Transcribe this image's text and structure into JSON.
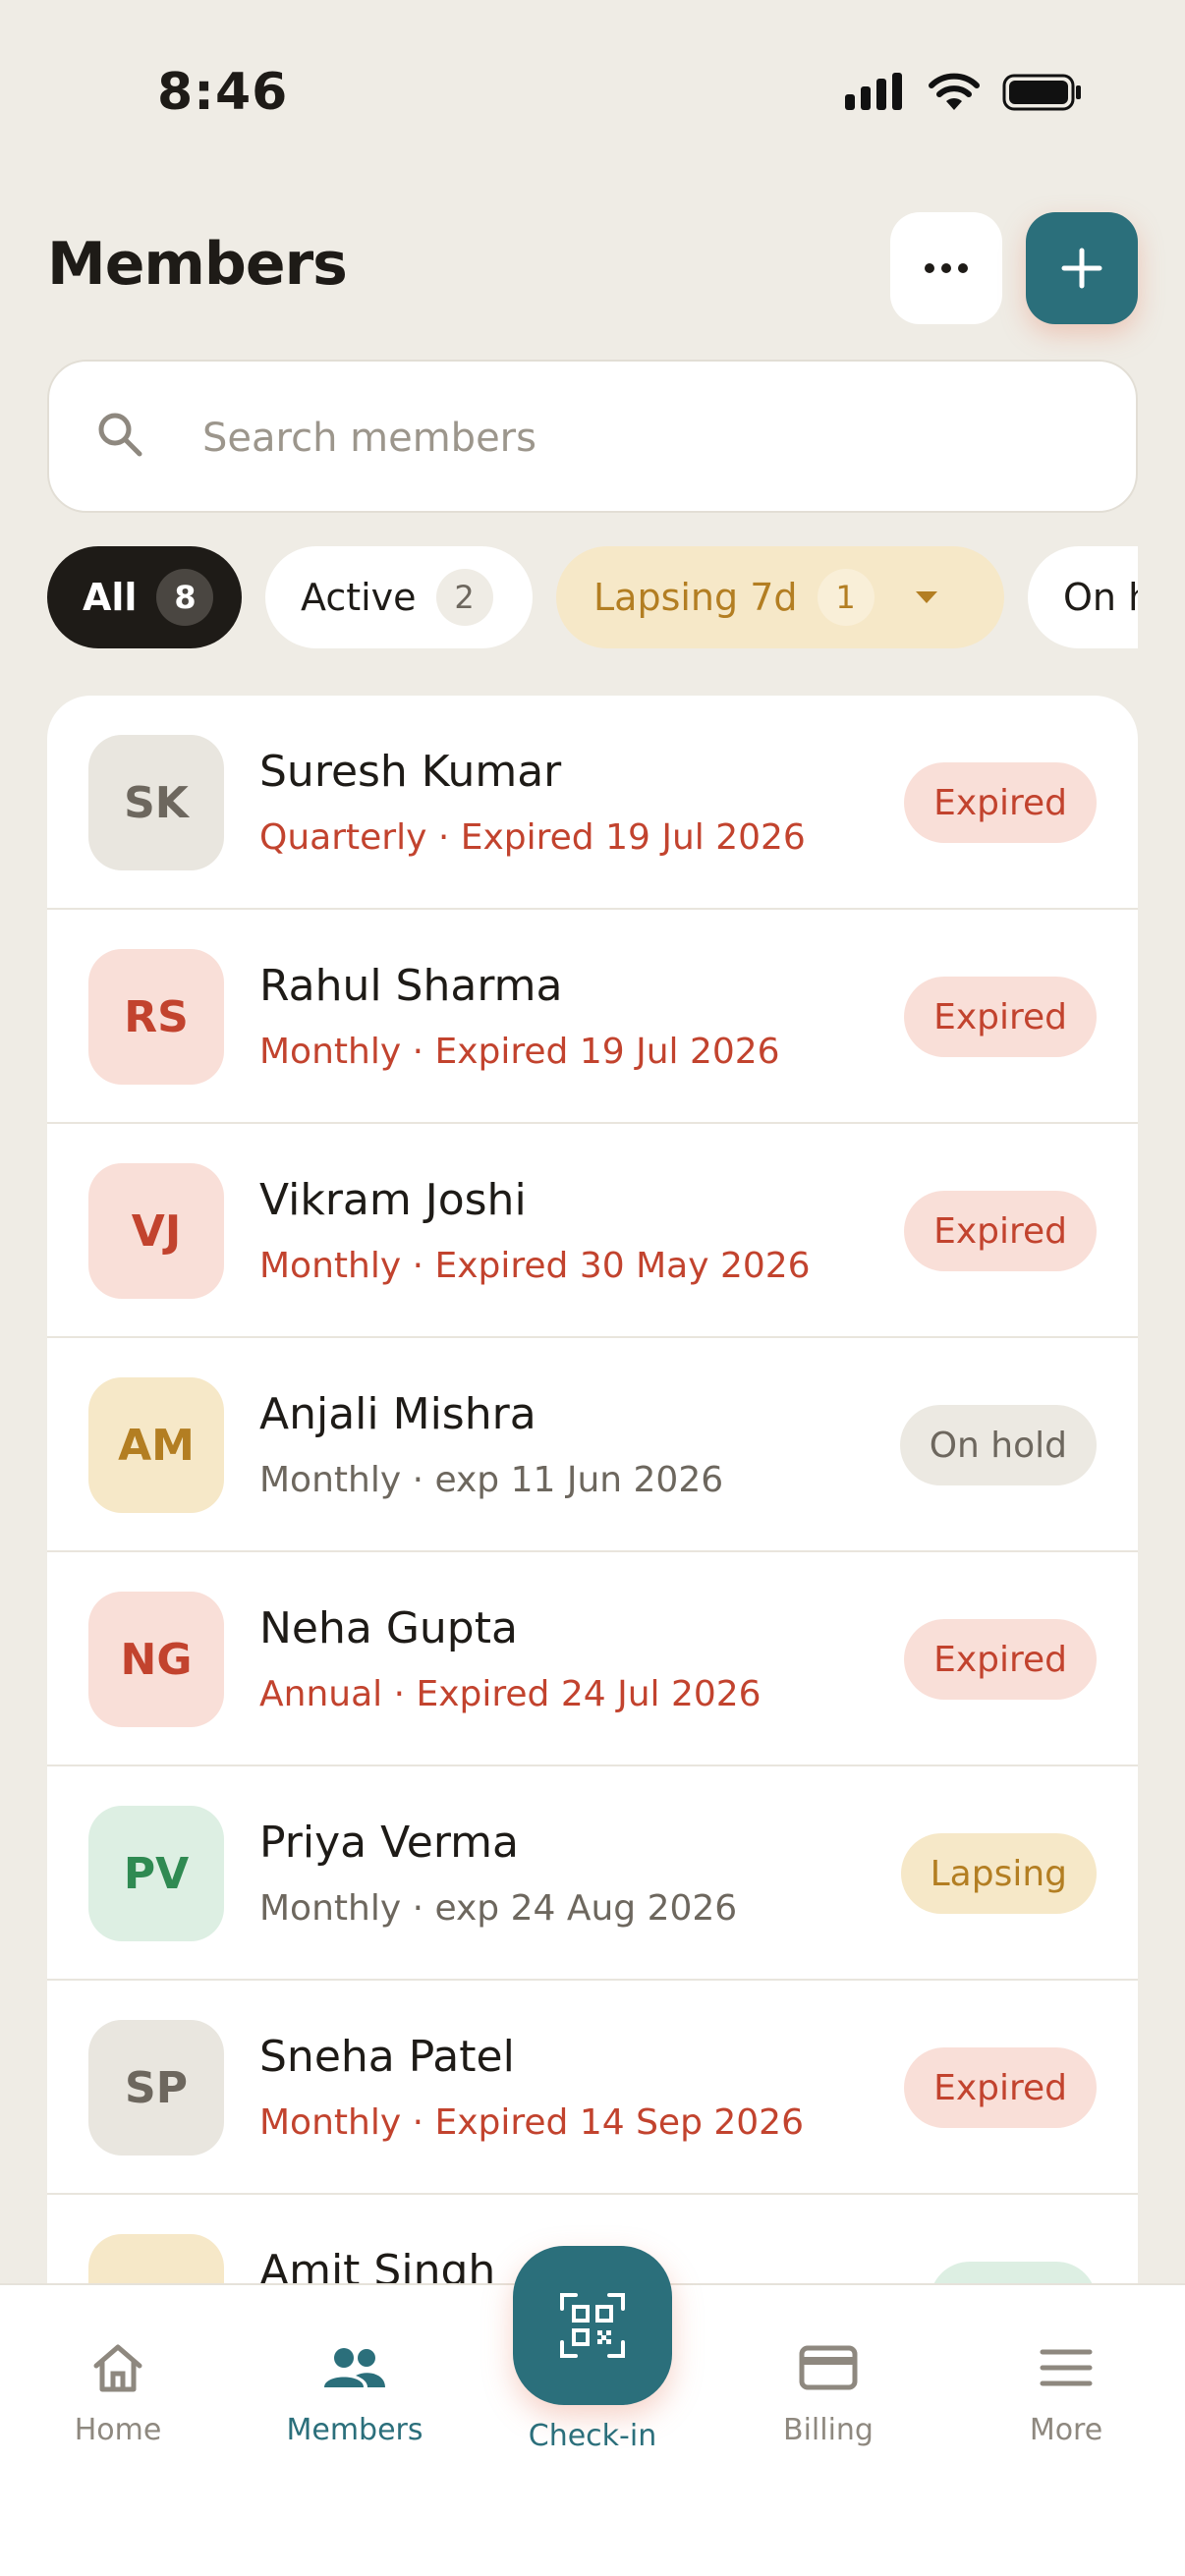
{
  "status_bar": {
    "time": "8:46"
  },
  "header": {
    "title": "Members"
  },
  "search": {
    "placeholder": "Search members"
  },
  "filters": [
    {
      "label": "All",
      "count": "8",
      "selected": true
    },
    {
      "label": "Active",
      "count": "2"
    },
    {
      "label": "Lapsing 7d",
      "count": "1"
    },
    {
      "label": "On hold"
    }
  ],
  "colors": {
    "accent": "#2B6F7B",
    "expired_text": "#C2432E",
    "expired_badge_bg": "#F9DFD8",
    "onhold_badge_bg": "#ECE9E2",
    "lapsing_badge_bg": "#F6E8C8",
    "lapsing_text": "#B37E22"
  },
  "members": [
    {
      "initials": "SK",
      "name": "Suresh Kumar",
      "meta": "Quarterly · Expired 19 Jul 2026",
      "status": "Expired"
    },
    {
      "initials": "RS",
      "name": "Rahul Sharma",
      "meta": "Monthly · Expired 19 Jul 2026",
      "status": "Expired"
    },
    {
      "initials": "VJ",
      "name": "Vikram Joshi",
      "meta": "Monthly · Expired 30 May 2026",
      "status": "Expired"
    },
    {
      "initials": "AM",
      "name": "Anjali Mishra",
      "meta": "Monthly · exp 11 Jun 2026",
      "status": "On hold"
    },
    {
      "initials": "NG",
      "name": "Neha Gupta",
      "meta": "Annual · Expired 24 Jul 2026",
      "status": "Expired"
    },
    {
      "initials": "PV",
      "name": "Priya Verma",
      "meta": "Monthly · exp 24 Aug 2026",
      "status": "Lapsing"
    },
    {
      "initials": "SP",
      "name": "Sneha Patel",
      "meta": "Monthly · Expired 14 Sep 2026",
      "status": "Expired"
    },
    {
      "initials": "",
      "name": "Amit Singh",
      "meta": "",
      "status": ""
    }
  ],
  "nav": {
    "home": "Home",
    "members": "Members",
    "checkin": "Check-in",
    "billing": "Billing",
    "more": "More"
  }
}
